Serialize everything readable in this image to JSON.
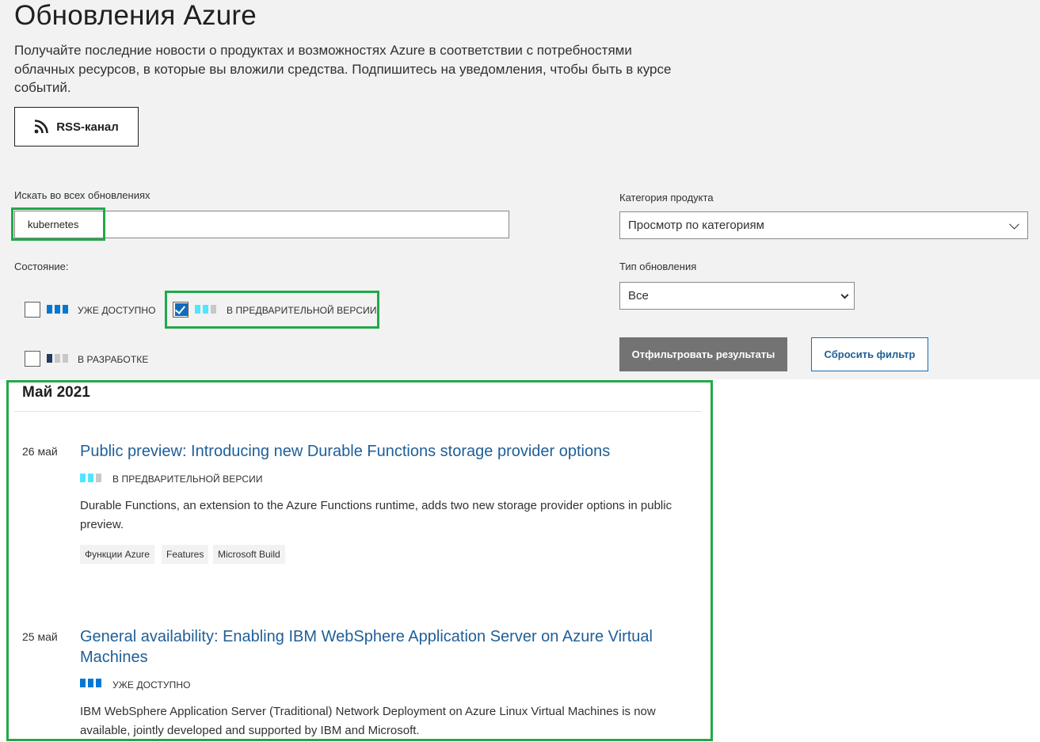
{
  "header": {
    "title": "Обновления Azure",
    "description": "Получайте последние новости о продуктах и возможностях Azure в соответствии с потребностями облачных ресурсов, в которые вы вложили средства. Подпишитесь на уведомления, чтобы быть в курсе событий.",
    "rss_label": "RSS-канал"
  },
  "filters": {
    "search_label": "Искать во всех обновлениях",
    "search_value": "kubernetes",
    "status_label": "Состояние:",
    "statuses": [
      {
        "label": "УЖЕ ДОСТУПНО",
        "checked": false
      },
      {
        "label": "В ПРЕДВАРИТЕЛЬНОЙ ВЕРСИИ",
        "checked": true
      },
      {
        "label": "В РАЗРАБОТКЕ",
        "checked": false
      }
    ],
    "category_label": "Категория продукта",
    "category_value": "Просмотр по категориям",
    "type_label": "Тип обновления",
    "type_value": "Все",
    "filter_button": "Отфильтровать результаты",
    "reset_button": "Сбросить фильтр"
  },
  "results": {
    "month": "Май 2021",
    "items": [
      {
        "date": "26 май",
        "title": "Public preview: Introducing new Durable Functions storage provider options",
        "status": "В ПРЕДВАРИТЕЛЬНОЙ ВЕРСИИ",
        "description": "Durable Functions, an extension to the Azure Functions runtime, adds two new storage provider options in public preview.",
        "tags": [
          "Функции Azure",
          "Features",
          "Microsoft Build"
        ]
      },
      {
        "date": "25 май",
        "title": "General availability: Enabling IBM WebSphere Application Server on Azure Virtual Machines",
        "status": "УЖЕ ДОСТУПНО",
        "description": "IBM WebSphere Application Server (Traditional) Network Deployment on Azure Linux Virtual Machines is now available, jointly developed and supported by IBM and Microsoft."
      }
    ]
  },
  "colors": {
    "available_bar": "#0078d4",
    "preview_bar": "#50e6ff",
    "preview_bar_light": "#c8c8c8",
    "dev_bar_dark": "#243a5e",
    "link": "#1f5f97",
    "highlight": "#22a84a"
  }
}
